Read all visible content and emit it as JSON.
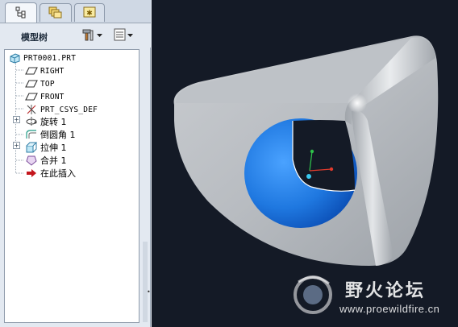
{
  "tree_panel": {
    "title": "模型树",
    "items": [
      {
        "label": "PRT0001.PRT",
        "icon": "part-icon"
      },
      {
        "label": "RIGHT",
        "icon": "datum-plane-icon"
      },
      {
        "label": "TOP",
        "icon": "datum-plane-icon"
      },
      {
        "label": "FRONT",
        "icon": "datum-plane-icon"
      },
      {
        "label": "PRT_CSYS_DEF",
        "icon": "csys-icon"
      },
      {
        "label": "旋转 1",
        "icon": "revolve-icon"
      },
      {
        "label": "倒圆角 1",
        "icon": "round-icon"
      },
      {
        "label": "拉伸 1",
        "icon": "extrude-icon"
      },
      {
        "label": "合并 1",
        "icon": "merge-icon"
      },
      {
        "label": "在此插入",
        "icon": "insert-here-arrow-icon"
      }
    ]
  },
  "watermark": {
    "title": "野火论坛",
    "url": "www.proewildfire.cn"
  },
  "colors": {
    "viewport_bg": "#141a26",
    "surface_gray": "#b4b8bd",
    "hole_blue": "#2a7fe6"
  }
}
